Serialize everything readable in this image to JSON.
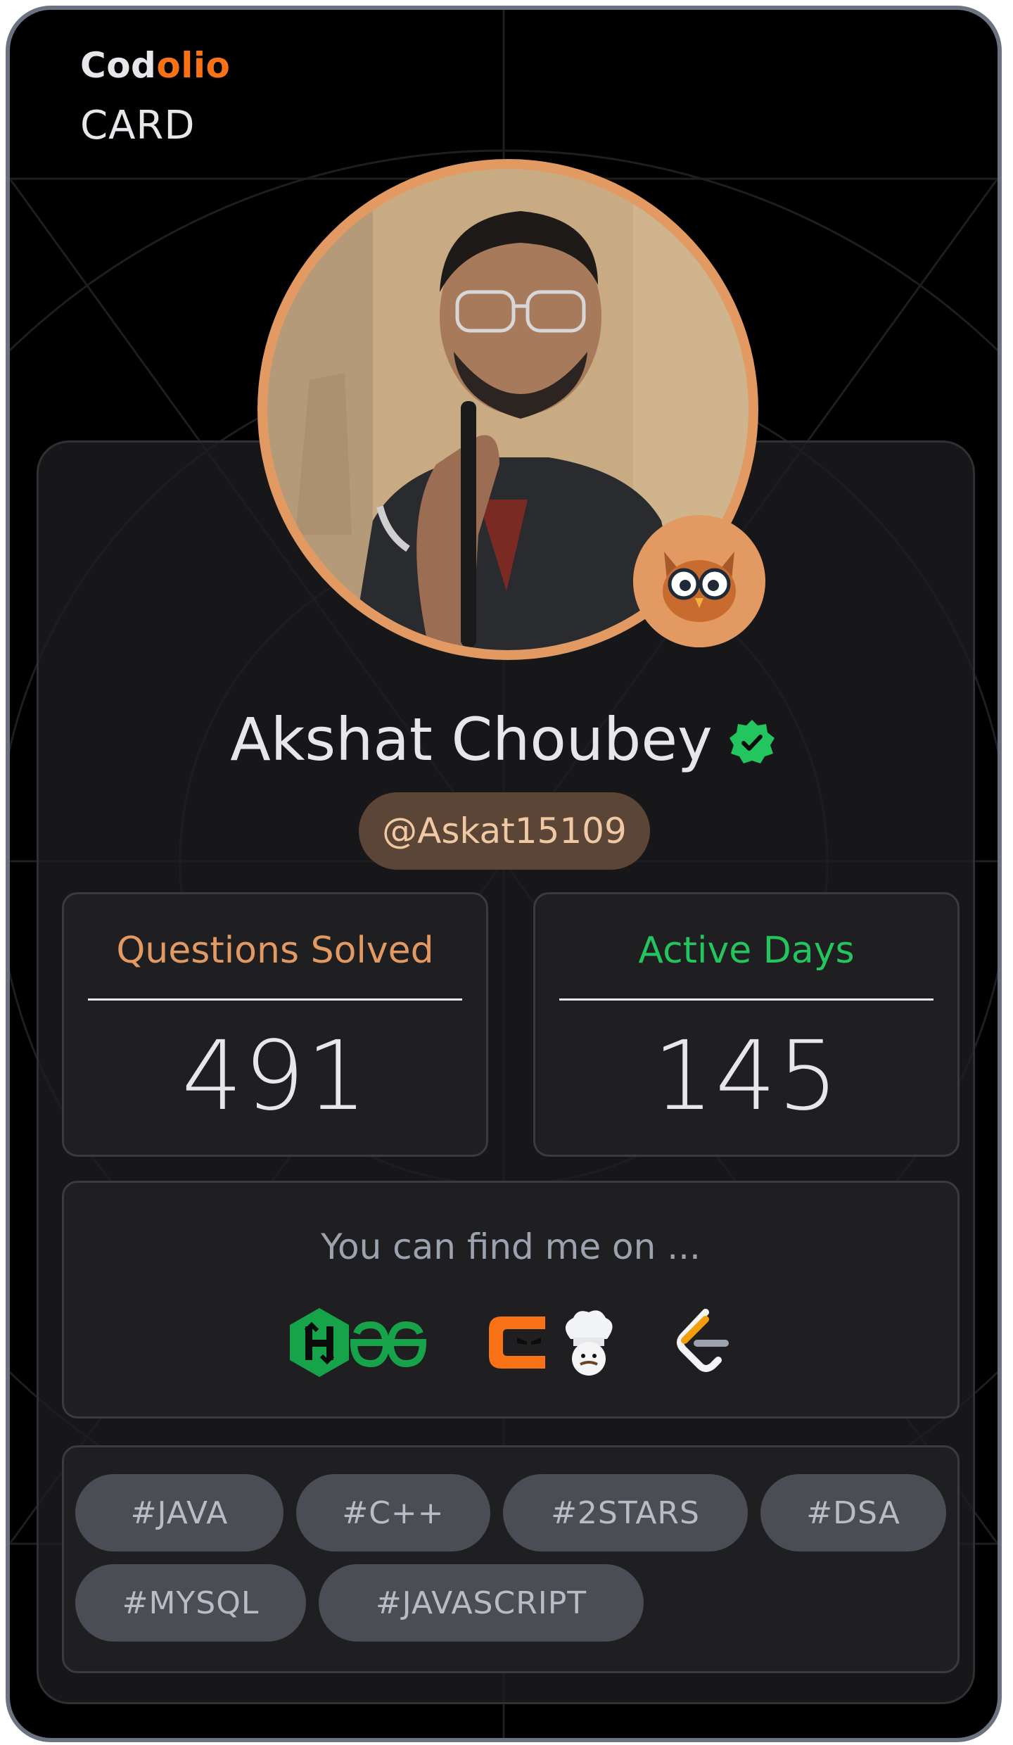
{
  "brand": {
    "name_part1": "Cod",
    "name_part2": "olio",
    "subtitle": "CARD"
  },
  "profile": {
    "name": "Akshat Choubey",
    "verified": true,
    "handle": "@Askat15109",
    "avatar_icon": "profile-photo",
    "badge_icon": "owl-icon"
  },
  "stats": {
    "questions_label": "Questions Solved",
    "questions_value": "491",
    "active_label": "Active Days",
    "active_value": "145"
  },
  "find_me": {
    "title": "You can find me on ...",
    "platforms": [
      "hackerrank-icon",
      "geeksforgeeks-icon",
      "codestudio-icon",
      "codechef-icon",
      "leetcode-icon"
    ]
  },
  "tags": [
    "#JAVA",
    "#C++",
    "#2STARS",
    "#DSA",
    "#MYSQL",
    "#JAVASCRIPT"
  ],
  "colors": {
    "accent_orange": "#f97316",
    "questions_label": "#e39a62",
    "active_label": "#22c55e",
    "avatar_ring": "#e39a62",
    "handle_bg": "#5a4537",
    "tag_bg": "#4b4d55"
  }
}
